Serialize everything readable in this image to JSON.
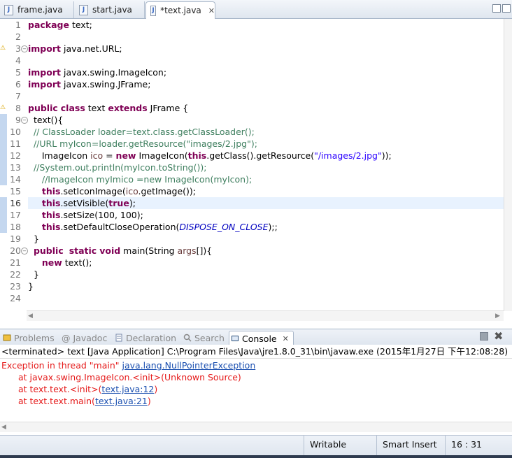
{
  "editor_tabs": [
    {
      "label": "frame.java",
      "active": false
    },
    {
      "label": "start.java",
      "active": false
    },
    {
      "label": "*text.java",
      "active": true
    }
  ],
  "code": {
    "line_numbers": [
      "1",
      "2",
      "3",
      "4",
      "5",
      "6",
      "7",
      "8",
      "9",
      "10",
      "11",
      "12",
      "13",
      "14",
      "15",
      "16",
      "17",
      "18",
      "19",
      "20",
      "21",
      "22",
      "23",
      "24"
    ],
    "current_line": "16",
    "lines": [
      [
        {
          "t": "package",
          "c": "kw"
        },
        {
          "t": " text;"
        }
      ],
      [],
      [
        {
          "t": "import",
          "c": "kw"
        },
        {
          "t": " java.net.URL;"
        }
      ],
      [],
      [
        {
          "t": "import",
          "c": "kw"
        },
        {
          "t": " javax.swing.ImageIcon;"
        }
      ],
      [
        {
          "t": "import",
          "c": "kw"
        },
        {
          "t": " javax.swing.JFrame;"
        }
      ],
      [],
      [
        {
          "t": "public",
          "c": "kw"
        },
        {
          "t": " "
        },
        {
          "t": "class",
          "c": "kw"
        },
        {
          "t": " text "
        },
        {
          "t": "extends",
          "c": "kw"
        },
        {
          "t": " JFrame {"
        }
      ],
      [
        {
          "t": "  text(){"
        }
      ],
      [
        {
          "t": "  // ClassLoader loader=text.class.getClassLoader();",
          "c": "cm"
        }
      ],
      [
        {
          "t": "  //URL myIcon=loader.getResource(\"images/2.jpg\");",
          "c": "cm"
        }
      ],
      [
        {
          "t": "     ImageIcon "
        },
        {
          "t": "ico",
          "c": "vr"
        },
        {
          "t": " = "
        },
        {
          "t": "new",
          "c": "kw"
        },
        {
          "t": " ImageIcon("
        },
        {
          "t": "this",
          "c": "kw"
        },
        {
          "t": ".getClass().getResource("
        },
        {
          "t": "\"/images/2.jpg\"",
          "c": "str"
        },
        {
          "t": "));"
        }
      ],
      [
        {
          "t": "  //System.out.println(myIcon.toString());",
          "c": "cm"
        }
      ],
      [
        {
          "t": "     //ImageIcon myImico =new ImageIcon(myIcon);",
          "c": "cm"
        }
      ],
      [
        {
          "t": "     "
        },
        {
          "t": "this",
          "c": "kw"
        },
        {
          "t": ".setIconImage("
        },
        {
          "t": "ico",
          "c": "vr"
        },
        {
          "t": ".getImage());"
        }
      ],
      [
        {
          "t": "     "
        },
        {
          "t": "this",
          "c": "kw"
        },
        {
          "t": ".setVisible("
        },
        {
          "t": "true",
          "c": "kw"
        },
        {
          "t": ");"
        }
      ],
      [
        {
          "t": "     "
        },
        {
          "t": "this",
          "c": "kw"
        },
        {
          "t": ".setSize(100, 100);"
        }
      ],
      [
        {
          "t": "     "
        },
        {
          "t": "this",
          "c": "kw"
        },
        {
          "t": ".setDefaultCloseOperation("
        },
        {
          "t": "DISPOSE_ON_CLOSE",
          "c": "fld"
        },
        {
          "t": ");;"
        }
      ],
      [
        {
          "t": "  }"
        }
      ],
      [
        {
          "t": "  "
        },
        {
          "t": "public",
          "c": "kw"
        },
        {
          "t": "  "
        },
        {
          "t": "static",
          "c": "kw"
        },
        {
          "t": " "
        },
        {
          "t": "void",
          "c": "kw"
        },
        {
          "t": " main(String "
        },
        {
          "t": "args",
          "c": "vr"
        },
        {
          "t": "[]){"
        }
      ],
      [
        {
          "t": "     "
        },
        {
          "t": "new",
          "c": "kw"
        },
        {
          "t": " text();"
        }
      ],
      [
        {
          "t": "  }"
        }
      ],
      [
        {
          "t": "}"
        }
      ],
      []
    ]
  },
  "bottom_tabs": [
    {
      "label": "Problems",
      "active": false
    },
    {
      "label": "@ Javadoc",
      "active": false
    },
    {
      "label": "Declaration",
      "active": false
    },
    {
      "label": "Search",
      "active": false
    },
    {
      "label": "Console",
      "active": true
    }
  ],
  "console": {
    "header": "<terminated> text [Java Application] C:\\Program Files\\Java\\jre1.8.0_31\\bin\\javaw.exe (2015年1月27日 下午12:08:28)",
    "exception_prefix": "Exception in thread \"main\" ",
    "exception_link": "java.lang.NullPointerException",
    "trace": [
      {
        "text": "at javax.swing.ImageIcon.<init>(Unknown Source)",
        "link": ""
      },
      {
        "text": "at text.text.<init>(",
        "link": "text.java:12",
        "suffix": ")"
      },
      {
        "text": "at text.text.main(",
        "link": "text.java:21",
        "suffix": ")"
      }
    ]
  },
  "status": {
    "writable": "Writable",
    "insert_mode": "Smart Insert",
    "position": "16 : 31"
  }
}
